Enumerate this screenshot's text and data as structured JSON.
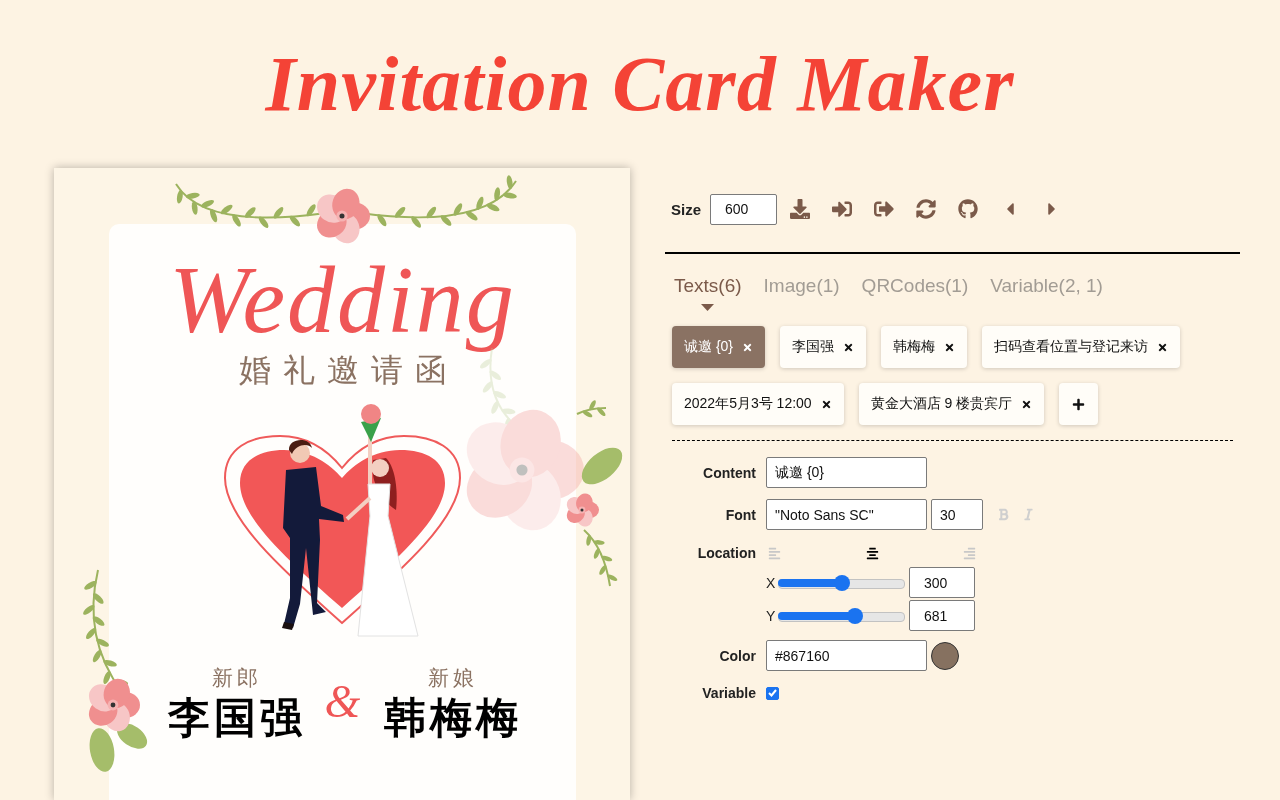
{
  "title": "Invitation Card Maker",
  "card": {
    "heading": "Wedding",
    "subtitle": "婚礼邀请函",
    "couple": [
      {
        "role": "新郎",
        "name": "李国强"
      },
      {
        "role": "新娘",
        "name": "韩梅梅"
      }
    ],
    "ampersand": "&"
  },
  "toolbar": {
    "size_label": "Size",
    "size_value": "600"
  },
  "tabs": [
    {
      "label": "Texts(6)",
      "selected": true
    },
    {
      "label": "Image(1)",
      "selected": false
    },
    {
      "label": "QRCodes(1)",
      "selected": false
    },
    {
      "label": "Variable(2, 1)",
      "selected": false
    }
  ],
  "text_items": [
    {
      "label": "诚邀 {0}",
      "selected": true
    },
    {
      "label": "李国强",
      "selected": false
    },
    {
      "label": "韩梅梅",
      "selected": false
    },
    {
      "label": "扫码查看位置与登记来访",
      "selected": false
    },
    {
      "label": "2022年5月3号 12:00",
      "selected": false
    },
    {
      "label": "黄金大酒店 9 楼贵宾厅",
      "selected": false
    }
  ],
  "form": {
    "content": {
      "label": "Content",
      "value": "诚邀 {0}"
    },
    "font": {
      "label": "Font",
      "family": "\"Noto Sans SC\"",
      "size": "30",
      "bold": false,
      "italic": false
    },
    "location": {
      "label": "Location",
      "alignments": [
        {
          "kind": "left",
          "selected": false
        },
        {
          "kind": "center",
          "selected": true
        },
        {
          "kind": "right",
          "selected": false
        }
      ],
      "axes": [
        {
          "label": "X",
          "value": "300",
          "level": 0.5
        },
        {
          "label": "Y",
          "value": "681",
          "level": 0.62
        }
      ]
    },
    "color": {
      "label": "Color",
      "value": "#867160"
    },
    "variable": {
      "label": "Variable",
      "checked": true
    }
  }
}
